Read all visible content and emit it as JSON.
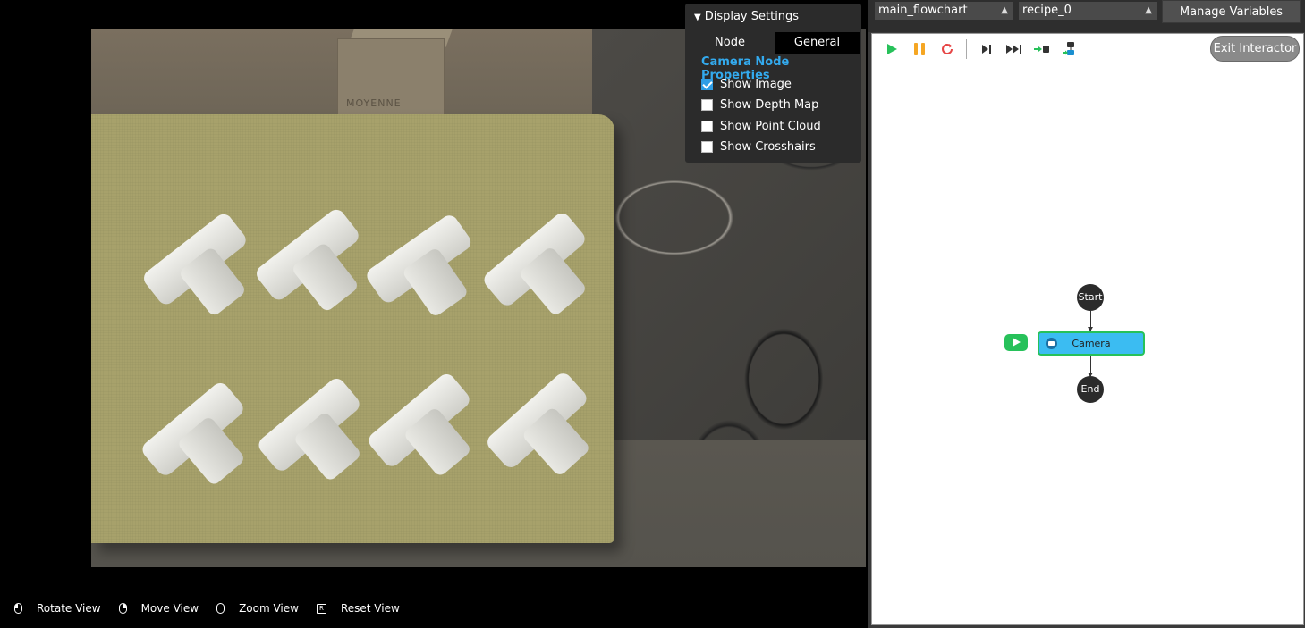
{
  "display_settings": {
    "header": "Display Settings",
    "tabs": [
      {
        "label": "Node"
      },
      {
        "label": "General"
      }
    ],
    "active_tab": "General",
    "section_title": "Camera Node Properties",
    "options": [
      {
        "label": "Show Image",
        "checked": true
      },
      {
        "label": "Show Depth Map",
        "checked": false
      },
      {
        "label": "Show Point Cloud",
        "checked": false
      },
      {
        "label": "Show Crosshairs",
        "checked": false
      }
    ]
  },
  "camera_image": {
    "box_label": "MOYENNE"
  },
  "view_hints": [
    {
      "icon": "mouse-left-icon",
      "label": "Rotate View"
    },
    {
      "icon": "mouse-right-icon",
      "label": "Move View"
    },
    {
      "icon": "mouse-wheel-icon",
      "label": "Zoom View"
    },
    {
      "icon": "key-r-icon",
      "key": "R",
      "label": "Reset View"
    }
  ],
  "top_bar": {
    "flowchart_select": "main_flowchart",
    "recipe_select": "recipe_0",
    "manage_variables": "Manage Variables"
  },
  "toolbar": {
    "exit_interactor": "Exit Interactor",
    "colors": {
      "play": "#27c15a",
      "pause": "#f5a623",
      "restart": "#e64545"
    }
  },
  "flowchart": {
    "start_label": "Start",
    "camera_label": "Camera",
    "end_label": "End",
    "camera_color": "#3bbcf2",
    "active_border": "#27c15a"
  }
}
